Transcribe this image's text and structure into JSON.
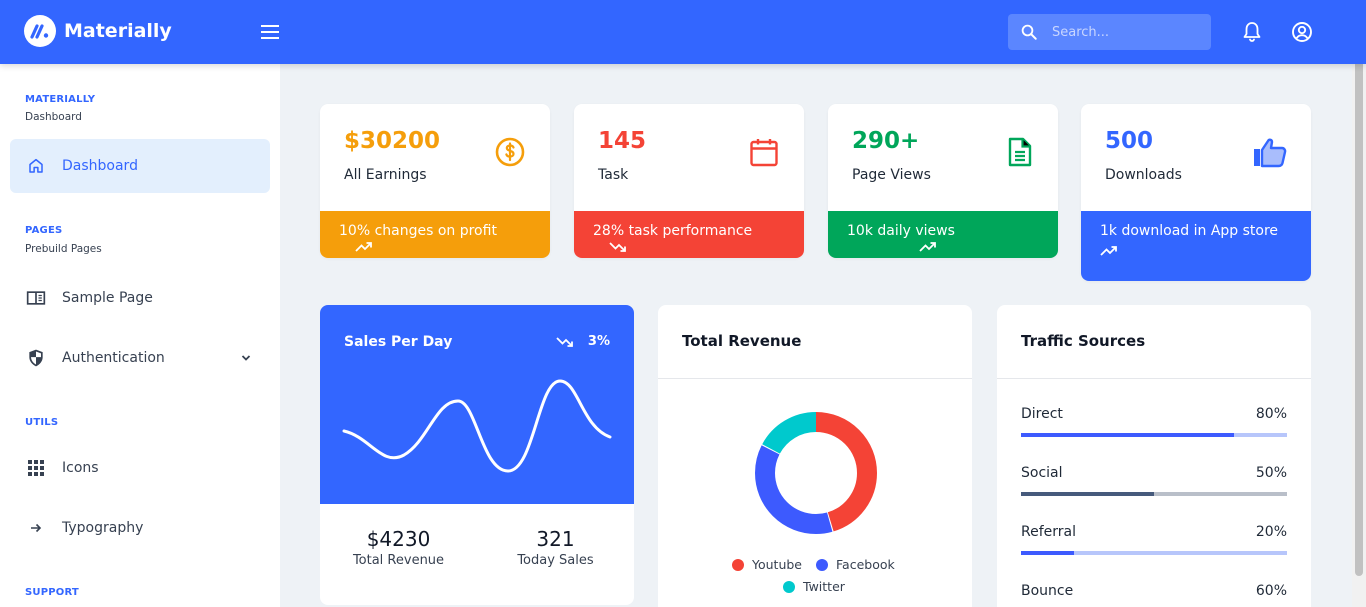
{
  "app": {
    "name": "Materially"
  },
  "header": {
    "search_placeholder": "Search..."
  },
  "sidebar": {
    "sections": [
      {
        "title": "MATERIALLY",
        "subtitle": "Dashboard"
      },
      {
        "title": "PAGES",
        "subtitle": "Prebuild Pages"
      },
      {
        "title": "UTILS"
      },
      {
        "title": "SUPPORT"
      }
    ],
    "items": [
      {
        "label": "Dashboard",
        "icon": "home-icon",
        "active": true
      },
      {
        "label": "Sample Page",
        "icon": "book-open-icon"
      },
      {
        "label": "Authentication",
        "icon": "security-shield-icon",
        "has_submenu": true
      },
      {
        "label": "Icons",
        "icon": "grid-dots-icon"
      },
      {
        "label": "Typography",
        "icon": "arrow-right-icon"
      }
    ]
  },
  "stats": [
    {
      "value": "$30200",
      "label": "All Earnings",
      "footer": "10% changes on profit",
      "color": "#f59e0b",
      "icon": "dollar-coin-icon",
      "trend": "up"
    },
    {
      "value": "145",
      "label": "Task",
      "footer": "28% task performance",
      "color": "#f44336",
      "icon": "calendar-icon",
      "trend": "down"
    },
    {
      "value": "290+",
      "label": "Page Views",
      "footer": "10k daily views",
      "color": "#00a65a",
      "icon": "document-icon",
      "trend": "up"
    },
    {
      "value": "500",
      "label": "Downloads",
      "footer": "1k download in App store",
      "color": "#3366ff",
      "icon": "thumbs-up-icon",
      "trend": "up"
    }
  ],
  "sales_per_day": {
    "title": "Sales Per Day",
    "percent": "3%",
    "trend": "down",
    "total_revenue_value": "$4230",
    "total_revenue_label": "Total Revenue",
    "today_sales_value": "321",
    "today_sales_label": "Today Sales"
  },
  "total_revenue": {
    "title": "Total Revenue",
    "legend": [
      {
        "name": "Youtube",
        "color": "#f44336"
      },
      {
        "name": "Facebook",
        "color": "#3d5afe"
      },
      {
        "name": "Twitter",
        "color": "#00c9cd"
      }
    ]
  },
  "traffic_sources": {
    "title": "Traffic Sources",
    "rows": [
      {
        "name": "Direct",
        "percent": "80%",
        "value": 0.8,
        "color": "#3d5afe"
      },
      {
        "name": "Social",
        "percent": "50%",
        "value": 0.5,
        "color": "#465a7c"
      },
      {
        "name": "Referral",
        "percent": "20%",
        "value": 0.2,
        "color": "#3d5afe"
      },
      {
        "name": "Bounce",
        "percent": "60%",
        "value": 0.6,
        "color": "#3d5afe"
      }
    ]
  }
}
